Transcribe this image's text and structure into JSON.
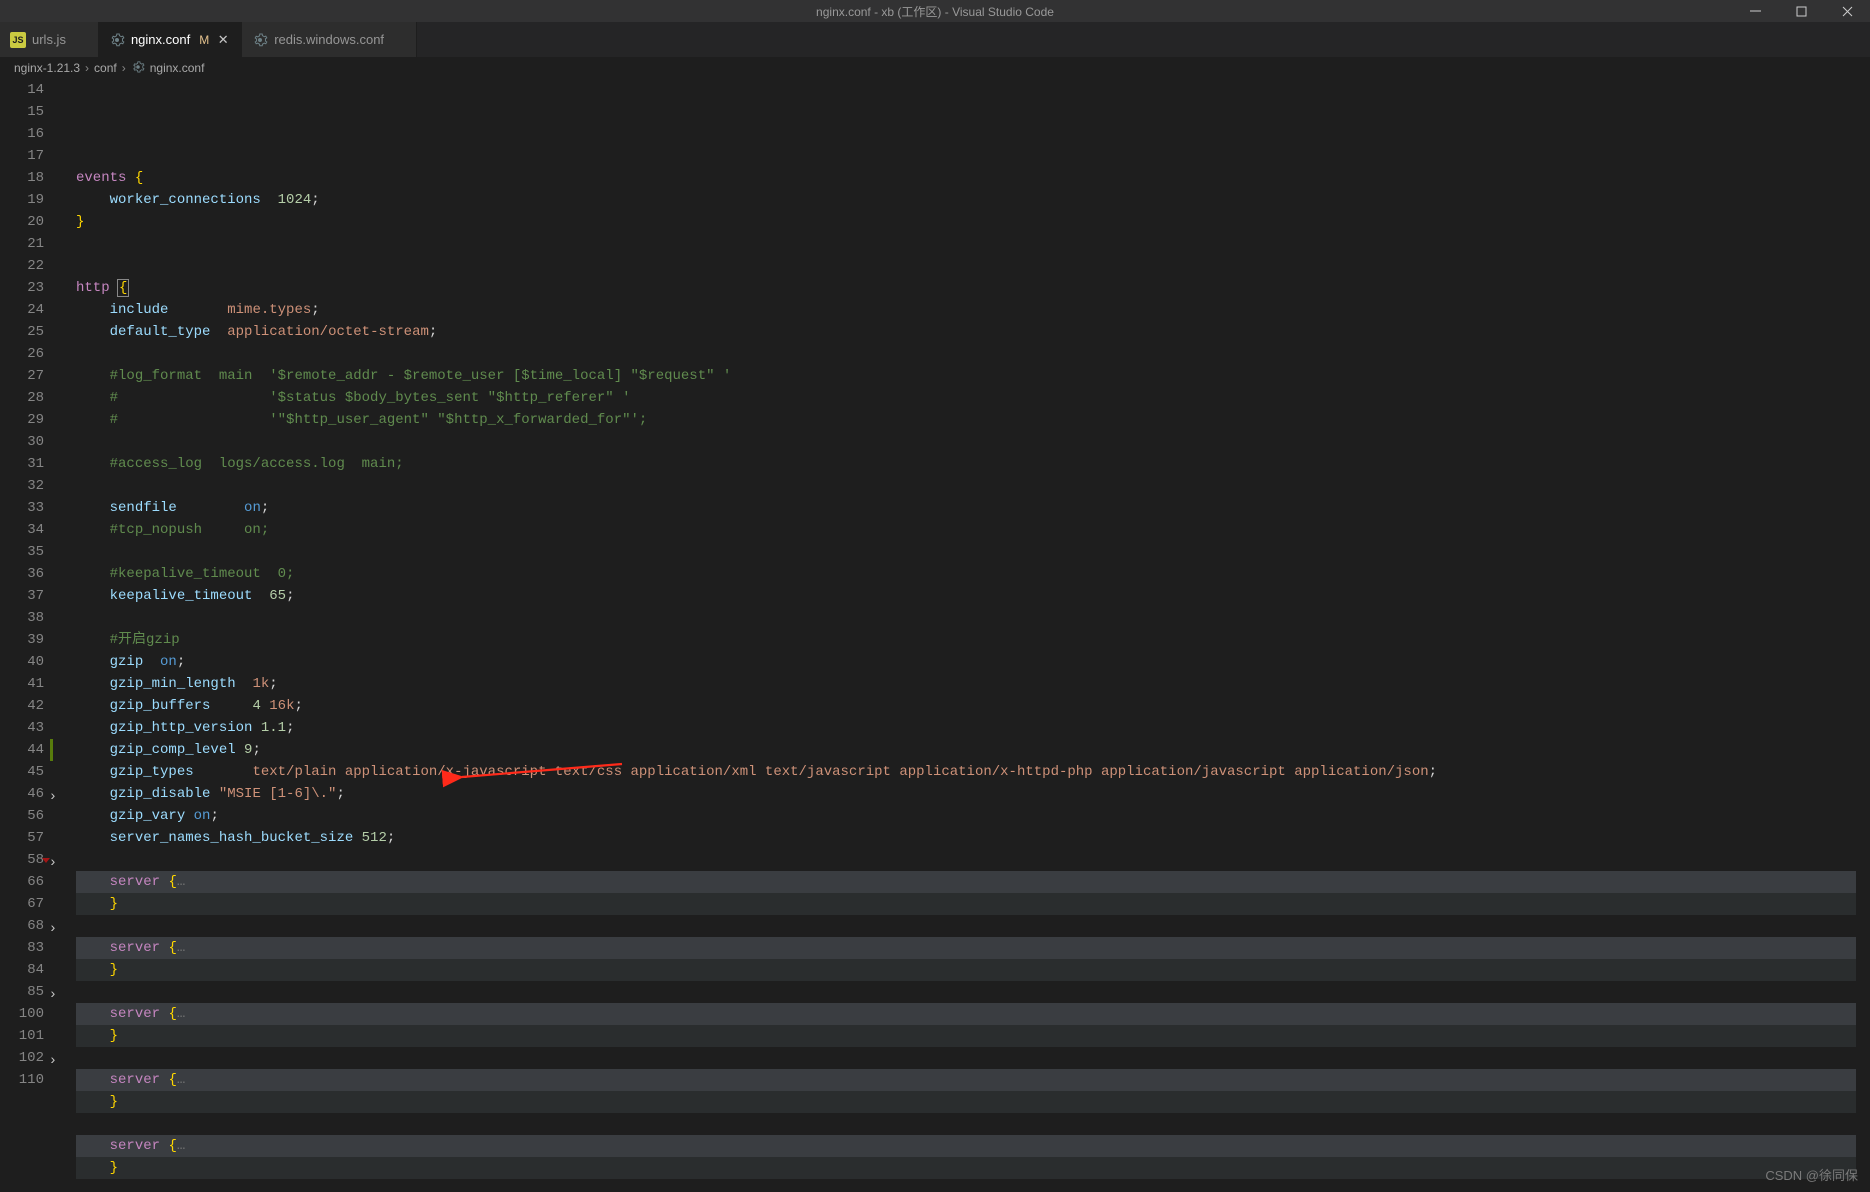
{
  "titlebar": {
    "title": "nginx.conf - xb (工作区) - Visual Studio Code"
  },
  "tabs": [
    {
      "icon": "js",
      "label": "urls.js",
      "modified": "",
      "active": false
    },
    {
      "icon": "gear",
      "label": "nginx.conf",
      "modified": "M",
      "active": true
    },
    {
      "icon": "gear",
      "label": "redis.windows.conf",
      "modified": "",
      "active": false
    }
  ],
  "breadcrumb": {
    "parts": [
      "nginx-1.21.3",
      "conf",
      "nginx.conf"
    ]
  },
  "code": {
    "lines": [
      {
        "n": 14,
        "t": [
          [
            "dir",
            "events"
          ],
          [
            "punct",
            " "
          ],
          [
            "brace",
            "{"
          ]
        ]
      },
      {
        "n": 15,
        "t": [
          [
            "",
            "    "
          ],
          [
            "prop",
            "worker_connections"
          ],
          [
            "",
            "  "
          ],
          [
            "num",
            "1024"
          ],
          [
            "punct",
            ";"
          ]
        ]
      },
      {
        "n": 16,
        "t": [
          [
            "brace",
            "}"
          ]
        ]
      },
      {
        "n": 17,
        "t": []
      },
      {
        "n": 18,
        "t": []
      },
      {
        "n": 19,
        "t": [
          [
            "dir",
            "http"
          ],
          [
            "punct",
            " "
          ],
          [
            "brace-box",
            "{"
          ]
        ]
      },
      {
        "n": 20,
        "t": [
          [
            "",
            "    "
          ],
          [
            "prop",
            "include"
          ],
          [
            "",
            "       "
          ],
          [
            "val",
            "mime.types"
          ],
          [
            "punct",
            ";"
          ]
        ]
      },
      {
        "n": 21,
        "t": [
          [
            "",
            "    "
          ],
          [
            "prop",
            "default_type"
          ],
          [
            "",
            "  "
          ],
          [
            "val",
            "application/octet-stream"
          ],
          [
            "punct",
            ";"
          ]
        ]
      },
      {
        "n": 22,
        "t": []
      },
      {
        "n": 23,
        "t": [
          [
            "",
            "    "
          ],
          [
            "cmt",
            "#log_format  main  '$remote_addr - $remote_user [$time_local] \"$request\" '"
          ]
        ]
      },
      {
        "n": 24,
        "t": [
          [
            "",
            "    "
          ],
          [
            "cmt",
            "#                  '$status $body_bytes_sent \"$http_referer\" '"
          ]
        ]
      },
      {
        "n": 25,
        "t": [
          [
            "",
            "    "
          ],
          [
            "cmt",
            "#                  '\"$http_user_agent\" \"$http_x_forwarded_for\"';"
          ]
        ]
      },
      {
        "n": 26,
        "t": []
      },
      {
        "n": 27,
        "t": [
          [
            "",
            "    "
          ],
          [
            "cmt",
            "#access_log  logs/access.log  main;"
          ]
        ]
      },
      {
        "n": 28,
        "t": []
      },
      {
        "n": 29,
        "t": [
          [
            "",
            "    "
          ],
          [
            "prop",
            "sendfile"
          ],
          [
            "",
            "        "
          ],
          [
            "kw",
            "on"
          ],
          [
            "punct",
            ";"
          ]
        ]
      },
      {
        "n": 30,
        "t": [
          [
            "",
            "    "
          ],
          [
            "cmt",
            "#tcp_nopush     on;"
          ]
        ]
      },
      {
        "n": 31,
        "t": []
      },
      {
        "n": 32,
        "t": [
          [
            "",
            "    "
          ],
          [
            "cmt",
            "#keepalive_timeout  0;"
          ]
        ]
      },
      {
        "n": 33,
        "t": [
          [
            "",
            "    "
          ],
          [
            "prop",
            "keepalive_timeout"
          ],
          [
            "",
            "  "
          ],
          [
            "num",
            "65"
          ],
          [
            "punct",
            ";"
          ]
        ]
      },
      {
        "n": 34,
        "t": []
      },
      {
        "n": 35,
        "t": [
          [
            "",
            "    "
          ],
          [
            "cmt",
            "#开启gzip"
          ]
        ]
      },
      {
        "n": 36,
        "t": [
          [
            "",
            "    "
          ],
          [
            "prop",
            "gzip"
          ],
          [
            "",
            "  "
          ],
          [
            "kw",
            "on"
          ],
          [
            "punct",
            ";"
          ]
        ]
      },
      {
        "n": 37,
        "t": [
          [
            "",
            "    "
          ],
          [
            "prop",
            "gzip_min_length"
          ],
          [
            "",
            "  "
          ],
          [
            "val",
            "1k"
          ],
          [
            "punct",
            ";"
          ]
        ]
      },
      {
        "n": 38,
        "t": [
          [
            "",
            "    "
          ],
          [
            "prop",
            "gzip_buffers"
          ],
          [
            "",
            "     "
          ],
          [
            "num",
            "4"
          ],
          [
            "",
            " "
          ],
          [
            "val",
            "16k"
          ],
          [
            "punct",
            ";"
          ]
        ]
      },
      {
        "n": 39,
        "t": [
          [
            "",
            "    "
          ],
          [
            "prop",
            "gzip_http_version"
          ],
          [
            "",
            " "
          ],
          [
            "num",
            "1.1"
          ],
          [
            "punct",
            ";"
          ]
        ]
      },
      {
        "n": 40,
        "t": [
          [
            "",
            "    "
          ],
          [
            "prop",
            "gzip_comp_level"
          ],
          [
            "",
            " "
          ],
          [
            "num",
            "9"
          ],
          [
            "punct",
            ";"
          ]
        ]
      },
      {
        "n": 41,
        "t": [
          [
            "",
            "    "
          ],
          [
            "prop",
            "gzip_types"
          ],
          [
            "",
            "       "
          ],
          [
            "val",
            "text/plain application/x-javascript text/css application/xml text/javascript application/x-httpd-php application/javascript application/json"
          ],
          [
            "punct",
            ";"
          ]
        ]
      },
      {
        "n": 42,
        "t": [
          [
            "",
            "    "
          ],
          [
            "prop",
            "gzip_disable"
          ],
          [
            "",
            " "
          ],
          [
            "str",
            "\"MSIE [1-6]\\.\""
          ],
          [
            "punct",
            ";"
          ]
        ]
      },
      {
        "n": 43,
        "t": [
          [
            "",
            "    "
          ],
          [
            "prop",
            "gzip_vary"
          ],
          [
            "",
            " "
          ],
          [
            "kw",
            "on"
          ],
          [
            "punct",
            ";"
          ]
        ]
      },
      {
        "n": 44,
        "modified": true,
        "t": [
          [
            "",
            "    "
          ],
          [
            "prop",
            "server_names_hash_bucket_size"
          ],
          [
            "",
            " "
          ],
          [
            "num",
            "512"
          ],
          [
            "punct",
            ";"
          ]
        ]
      },
      {
        "n": 45,
        "t": []
      },
      {
        "n": 46,
        "fold": true,
        "hl": "closed",
        "t": [
          [
            "",
            "    "
          ],
          [
            "dir",
            "server"
          ],
          [
            "",
            " "
          ],
          [
            "brace",
            "{"
          ],
          [
            "ellipsis",
            "…"
          ]
        ]
      },
      {
        "n": 56,
        "hl": "block",
        "t": [
          [
            "",
            "    "
          ],
          [
            "brace",
            "}"
          ]
        ]
      },
      {
        "n": 57,
        "t": []
      },
      {
        "n": 58,
        "fold": true,
        "dirty": true,
        "hl": "closed",
        "t": [
          [
            "",
            "    "
          ],
          [
            "dir",
            "server"
          ],
          [
            "",
            " "
          ],
          [
            "brace",
            "{"
          ],
          [
            "ellipsis",
            "…"
          ]
        ]
      },
      {
        "n": 66,
        "hl": "block",
        "t": [
          [
            "",
            "    "
          ],
          [
            "brace",
            "}"
          ]
        ]
      },
      {
        "n": 67,
        "t": []
      },
      {
        "n": 68,
        "fold": true,
        "hl": "closed",
        "t": [
          [
            "",
            "    "
          ],
          [
            "dir",
            "server"
          ],
          [
            "",
            " "
          ],
          [
            "brace",
            "{"
          ],
          [
            "ellipsis",
            "…"
          ]
        ]
      },
      {
        "n": 83,
        "hl": "block",
        "t": [
          [
            "",
            "    "
          ],
          [
            "brace",
            "}"
          ]
        ]
      },
      {
        "n": 84,
        "t": []
      },
      {
        "n": 85,
        "fold": true,
        "hl": "closed",
        "t": [
          [
            "",
            "    "
          ],
          [
            "dir",
            "server"
          ],
          [
            "",
            " "
          ],
          [
            "brace",
            "{"
          ],
          [
            "ellipsis",
            "…"
          ]
        ]
      },
      {
        "n": 100,
        "hl": "block",
        "t": [
          [
            "",
            "    "
          ],
          [
            "brace",
            "}"
          ]
        ]
      },
      {
        "n": 101,
        "t": []
      },
      {
        "n": 102,
        "fold": true,
        "hl": "closed",
        "t": [
          [
            "",
            "    "
          ],
          [
            "dir",
            "server"
          ],
          [
            "",
            " "
          ],
          [
            "brace",
            "{"
          ],
          [
            "ellipsis",
            "…"
          ]
        ]
      },
      {
        "n": 110,
        "hl": "block",
        "t": [
          [
            "",
            "    "
          ],
          [
            "brace",
            "}"
          ]
        ]
      }
    ]
  },
  "watermark": "CSDN @徐同保"
}
